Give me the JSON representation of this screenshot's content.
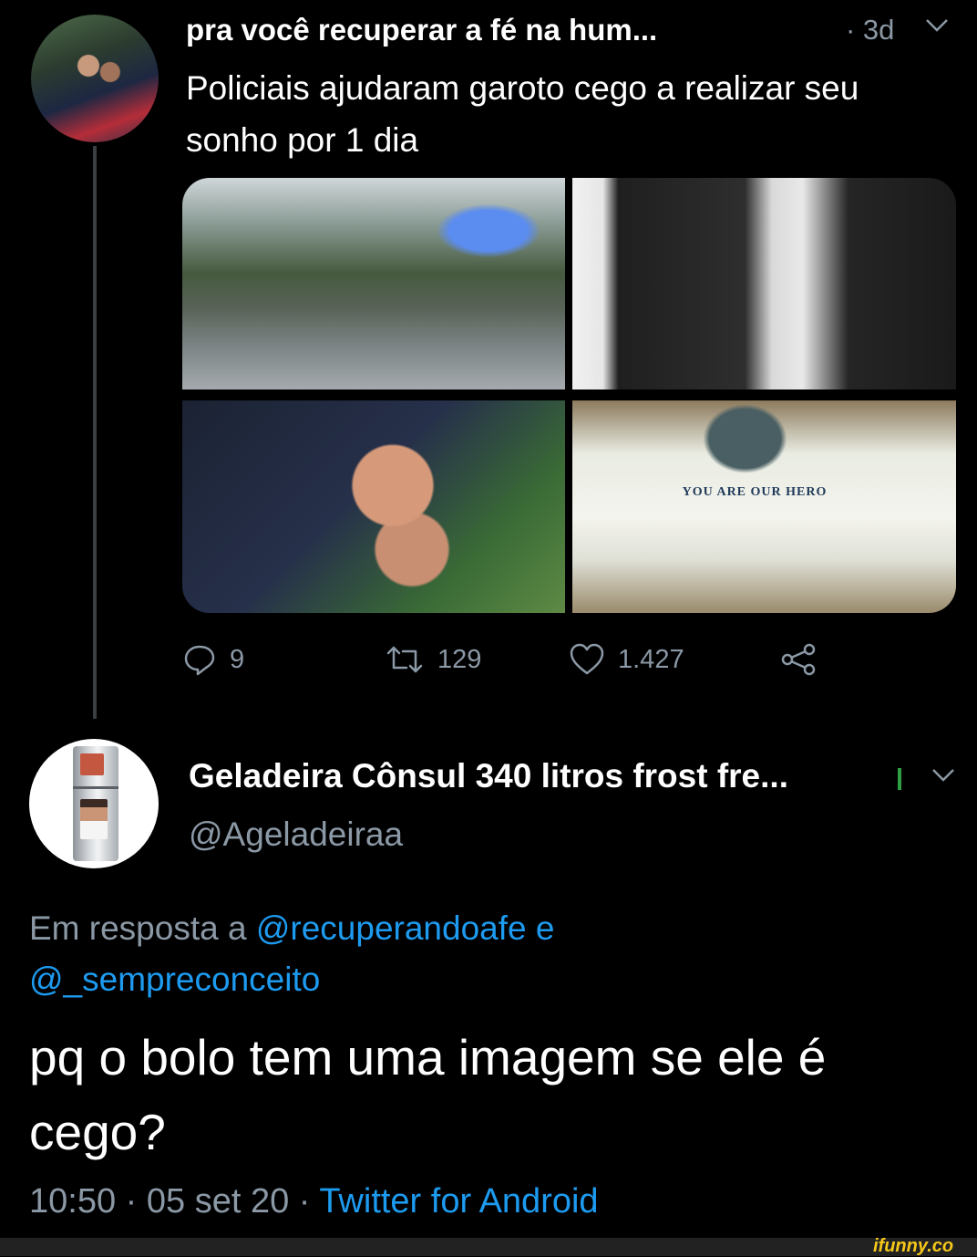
{
  "tweet1": {
    "author_name": "pra você recuperar a fé na hum...",
    "meta": "· 3d",
    "text": "Policiais ajudaram garoto cego a realizar seu sonho por 1 dia",
    "cake_text": "YOU ARE OUR HERO",
    "actions": {
      "replies": "9",
      "retweets": "129",
      "likes": "1.427"
    }
  },
  "tweet2": {
    "author_name": "Geladeira Cônsul 340 litros frost fre...",
    "handle": "@Ageladeiraa",
    "reply_prefix": "Em resposta a",
    "reply_user1": "@recuperandoafe",
    "reply_and": "e",
    "reply_user2": "@_sempreconceito",
    "text": "pq o bolo tem uma imagem se ele é cego?",
    "time": "10:50",
    "date": "05 set 20",
    "source": "Twitter for Android"
  },
  "watermark": "ifunny.co",
  "colors": {
    "background": "#000000",
    "secondary_text": "#8b98a5",
    "link": "#1d9bf0"
  }
}
